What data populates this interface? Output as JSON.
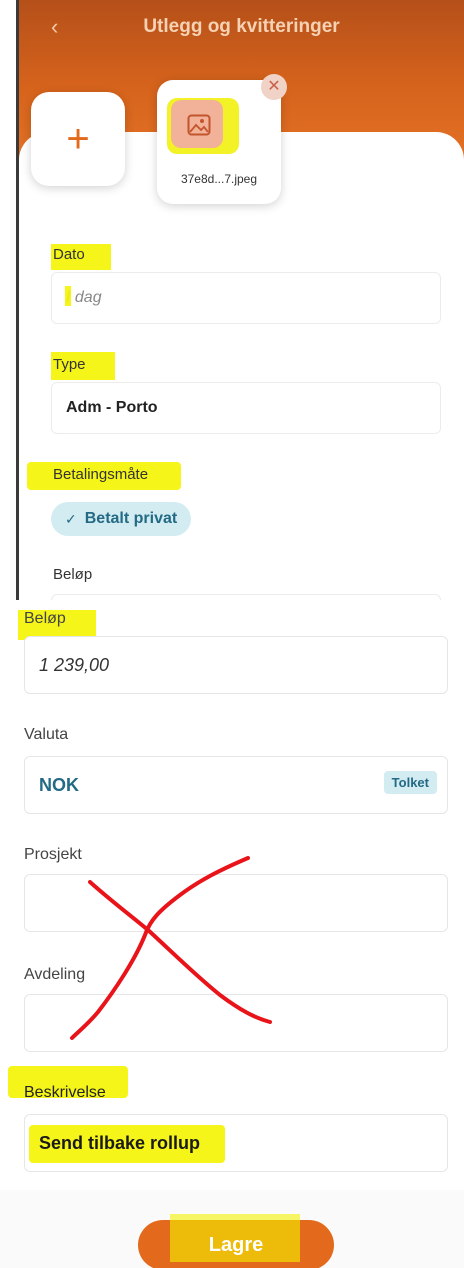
{
  "header": {
    "title": "Utlegg og kvitteringer",
    "back_icon": "chevron-left-icon"
  },
  "attachments": {
    "add_icon": "plus-icon",
    "file_name": "37e8d...7.jpeg",
    "remove_icon": "close-icon"
  },
  "form_top": {
    "date_label": "Dato",
    "date_placeholder": "I dag",
    "type_label": "Type",
    "type_value": "Adm - Porto",
    "payment_label": "Betalingsmåte",
    "payment_chip": "Betalt privat",
    "amount_label": "Beløp"
  },
  "form_bottom": {
    "amount_label": "Beløp",
    "amount_value": "1 239,00",
    "currency_label": "Valuta",
    "currency_value": "NOK",
    "currency_badge": "Tolket",
    "project_label": "Prosjekt",
    "project_value": "",
    "department_label": "Avdeling",
    "department_value": "",
    "description_label": "Beskrivelse",
    "description_value": "Send tilbake rollup"
  },
  "footer": {
    "save_label": "Lagre"
  },
  "colors": {
    "accent": "#e36a1d",
    "chip_bg": "#d3ecf2",
    "chip_text": "#236a85",
    "highlight": "#f4f400",
    "annotation": "#e8141a"
  }
}
